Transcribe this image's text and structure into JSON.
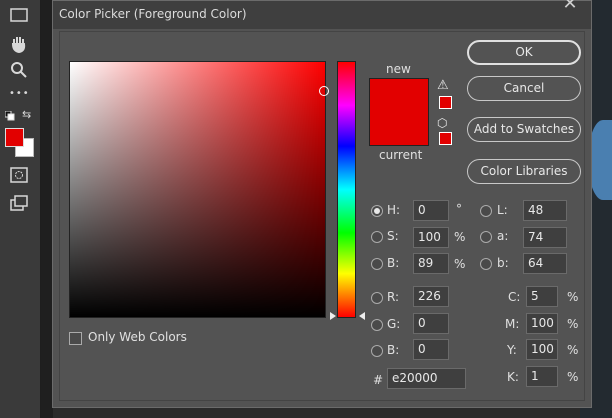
{
  "dialog": {
    "title": "Color Picker (Foreground Color)",
    "close_symbol": "✕"
  },
  "swatch": {
    "new_label": "new",
    "current_label": "current",
    "color": "#e20000"
  },
  "buttons": {
    "ok": "OK",
    "cancel": "Cancel",
    "add_to_swatches": "Add to Swatches",
    "color_libraries": "Color Libraries"
  },
  "only_web_colors": "Only Web Colors",
  "hsb": {
    "h_label": "H:",
    "h_value": "0",
    "h_unit": "°",
    "s_label": "S:",
    "s_value": "100",
    "s_unit": "%",
    "b_label": "B:",
    "b_value": "89",
    "b_unit": "%"
  },
  "lab": {
    "l_label": "L:",
    "l_value": "48",
    "a_label": "a:",
    "a_value": "74",
    "b_label": "b:",
    "b_value": "64"
  },
  "rgb": {
    "r_label": "R:",
    "r_value": "226",
    "g_label": "G:",
    "g_value": "0",
    "b_label": "B:",
    "b_value": "0"
  },
  "cmyk": {
    "c_label": "C:",
    "c_value": "5",
    "m_label": "M:",
    "m_value": "100",
    "y_label": "Y:",
    "y_value": "100",
    "k_label": "K:",
    "k_value": "1",
    "unit": "%"
  },
  "hex": {
    "label": "#",
    "value": "e20000"
  },
  "icons": {
    "warning": "⚠",
    "cube": "⬡",
    "marquee": "▭",
    "hand": "✋",
    "zoom": "⚲",
    "more": "•••",
    "swap": "⇆"
  }
}
